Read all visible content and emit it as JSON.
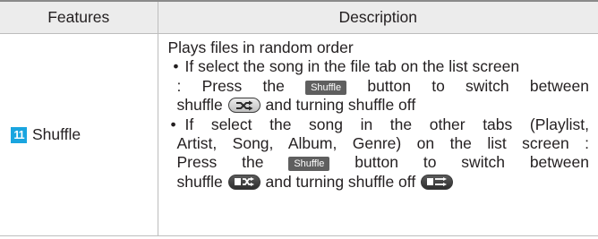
{
  "table": {
    "header_features": "Features",
    "header_description": "Description"
  },
  "row": {
    "number": "11",
    "feature": "Shuffle",
    "intro": "Plays files in random order",
    "bullet1": {
      "l1": "If select the song in the file tab on the list screen",
      "l2a": ": Press the",
      "button": "Shuffle",
      "l2b": "button to switch between",
      "l3a": "shuffle",
      "l3b": "and turning shuffle off"
    },
    "bullet2": {
      "l1": "If select the song in the other tabs (Playlist,",
      "l2": "Artist, Song, Album, Genre) on the list screen :",
      "l3a": "Press the",
      "button": "Shuffle",
      "l3b": "button to switch between",
      "l4a": "shuffle",
      "l4b": "and turning shuffle off"
    },
    "bullet_glyph": "•"
  },
  "icons": {
    "shuffle_on": "shuffle-icon",
    "shuffle_all_on": "shuffle-all-icon",
    "shuffle_off": "shuffle-off-icon"
  }
}
